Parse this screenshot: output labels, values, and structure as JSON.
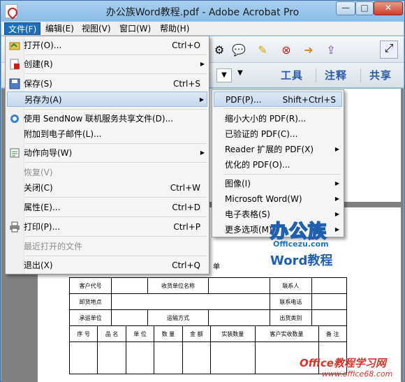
{
  "window": {
    "title": "办公族Word教程.pdf - Adobe Acrobat Pro",
    "min": "—",
    "max": "□",
    "close": "✕"
  },
  "menubar": [
    "文件(F)",
    "编辑(E)",
    "视图(V)",
    "窗口(W)",
    "帮助(H)"
  ],
  "toolbar2": {
    "tools": "工具",
    "comment": "注释",
    "share": "共享"
  },
  "file_menu": [
    {
      "label": "打开(O)...",
      "shortcut": "Ctrl+O"
    },
    {
      "label": "创建(R)",
      "shortcut": ""
    },
    {
      "label": "保存(S)",
      "shortcut": "Ctrl+S"
    },
    {
      "label": "另存为(A)",
      "shortcut": ""
    },
    {
      "label": "使用 SendNow 联机服务共享文件(D)...",
      "shortcut": ""
    },
    {
      "label": "附加到电子邮件(L)...",
      "shortcut": ""
    },
    {
      "label": "动作向导(W)",
      "shortcut": ""
    },
    {
      "label": "恢复(V)",
      "shortcut": ""
    },
    {
      "label": "关闭(C)",
      "shortcut": "Ctrl+W"
    },
    {
      "label": "属性(E)...",
      "shortcut": "Ctrl+D"
    },
    {
      "label": "打印(P)...",
      "shortcut": "Ctrl+P"
    },
    {
      "label": "最近打开的文件",
      "shortcut": ""
    },
    {
      "label": "退出(X)",
      "shortcut": "Ctrl+Q"
    }
  ],
  "saveas_menu": [
    {
      "label": "PDF(P)...",
      "shortcut": "Shift+Ctrl+S"
    },
    {
      "label": "缩小大小的 PDF(R)...",
      "shortcut": ""
    },
    {
      "label": "已验证的 PDF(C)...",
      "shortcut": ""
    },
    {
      "label": "Reader 扩展的 PDF(X)",
      "shortcut": ""
    },
    {
      "label": "优化的 PDF(O)...",
      "shortcut": ""
    },
    {
      "label": "图像(I)",
      "shortcut": ""
    },
    {
      "label": "Microsoft Word(W)",
      "shortcut": ""
    },
    {
      "label": "电子表格(S)",
      "shortcut": ""
    },
    {
      "label": "更多选项(M)",
      "shortcut": ""
    }
  ],
  "document": {
    "title_fragment": "单",
    "rows": [
      [
        "客户代号",
        "",
        "收货单位名称",
        "",
        "联系人",
        ""
      ],
      [
        "卸货地点",
        "",
        "",
        "",
        "联系电话",
        ""
      ],
      [
        "承运单位",
        "",
        "运输方式",
        "",
        "出货类别",
        ""
      ]
    ],
    "header_row": [
      "序 号",
      "品 名",
      "单 位",
      "数 量",
      "金 额",
      "实装数量",
      "客户实收数量",
      "备 注"
    ]
  },
  "watermark": {
    "logo_main": "办公族",
    "logo_site": "Officezu.com",
    "logo_sub": "Word教程",
    "corner_main": "Office教程学习网",
    "corner_site": "www.office68.com"
  }
}
